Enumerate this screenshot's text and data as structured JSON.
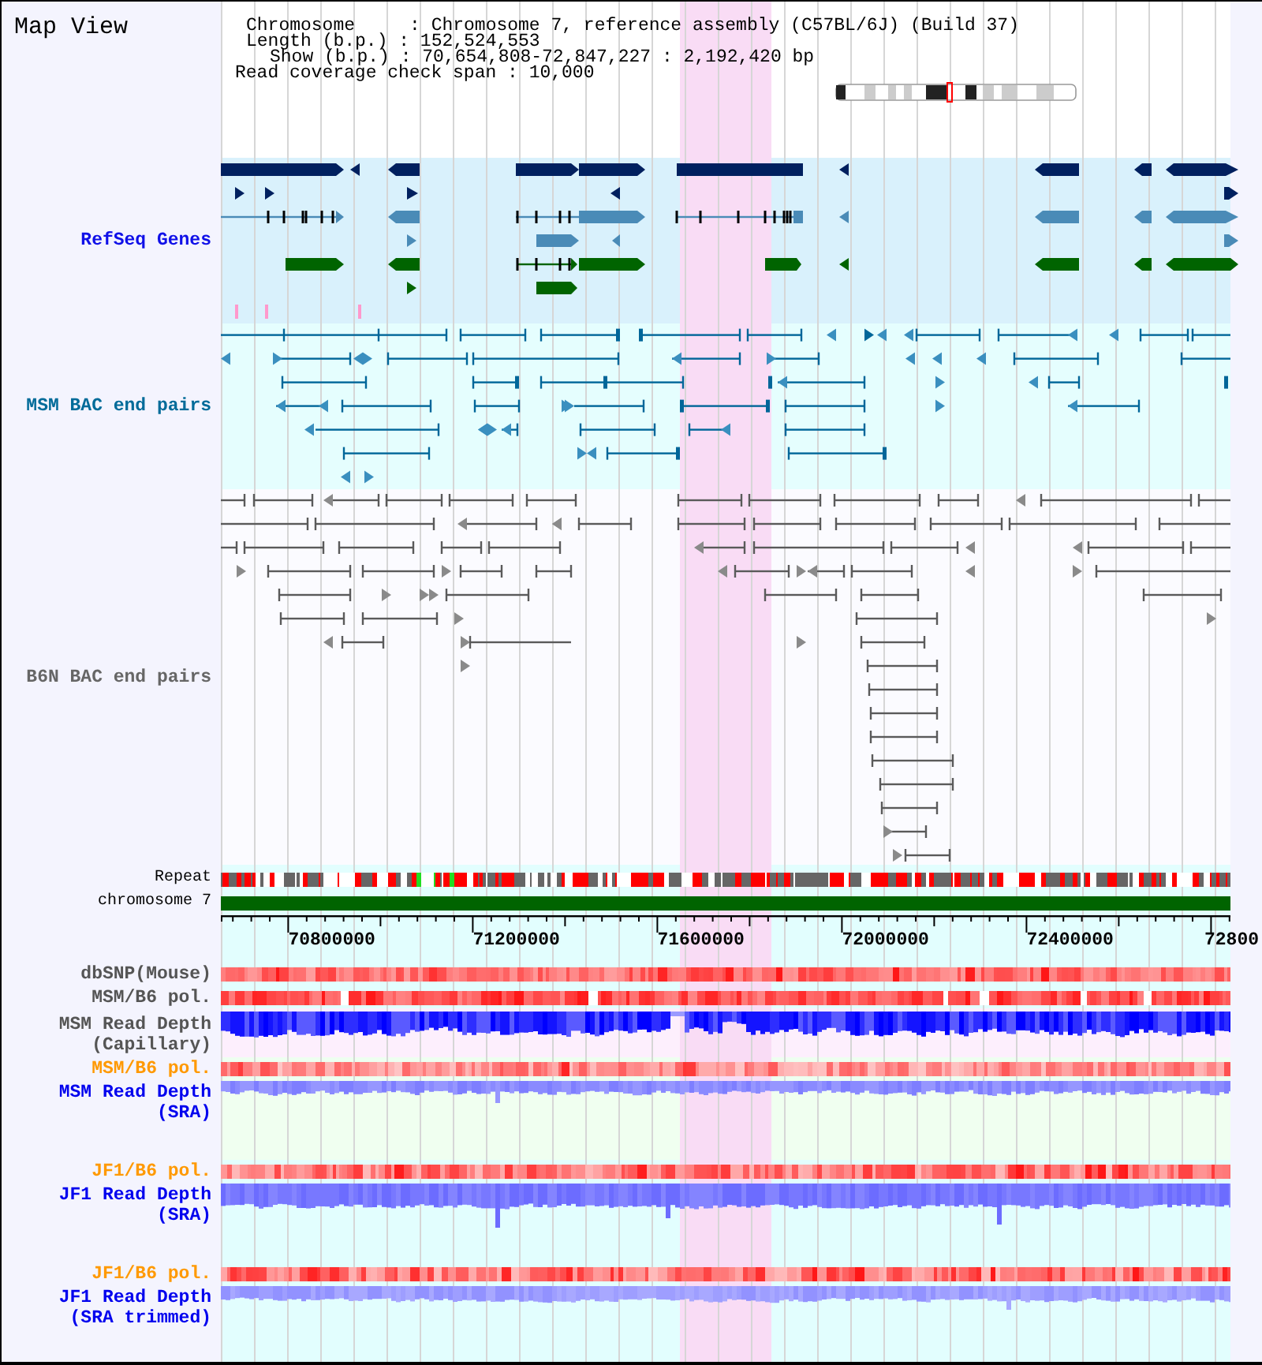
{
  "title": "Map View",
  "header": {
    "lines": [
      "Chromosome     : Chromosome 7, reference assembly (C57BL/6J) (Build 37)",
      "Length (b.p.) : 152,524,553",
      "Show (b.p.) : 70,654,808-72,847,227 : 2,192,420 bp",
      "Read coverage check span : 10,000"
    ]
  },
  "tracks": [
    {
      "kind": "genes",
      "label": "RefSeq Genes",
      "color": "#1010e8"
    },
    {
      "kind": "bac_pairs",
      "label": "MSM BAC end pairs",
      "color": "#006b99"
    },
    {
      "kind": "bac_pairs",
      "label": "B6N BAC end pairs",
      "color": "#666666"
    },
    {
      "kind": "repeat",
      "label": "Repeat",
      "color": "#000000"
    },
    {
      "kind": "chromosome",
      "label": "chromosome 7",
      "color": "#000000"
    },
    {
      "kind": "axis",
      "ticks": [
        "70800000",
        "71200000",
        "71600000",
        "72000000",
        "72400000",
        "72800"
      ]
    },
    {
      "kind": "heat",
      "label": "dbSNP(Mouse)",
      "color": "#555555"
    },
    {
      "kind": "heat",
      "label": "MSM/B6 pol.",
      "color": "#555555"
    },
    {
      "kind": "depth",
      "label": "MSM Read Depth (Capillary)",
      "color": "#555555"
    },
    {
      "kind": "heat",
      "label": "MSM/B6 pol.",
      "color": "#ff9900"
    },
    {
      "kind": "depth",
      "label": "MSM Read Depth (SRA)",
      "color": "#0000ee"
    },
    {
      "kind": "heat",
      "label": "JF1/B6 pol.",
      "color": "#ff9900"
    },
    {
      "kind": "depth",
      "label": "JF1 Read Depth (SRA)",
      "color": "#0000ee"
    },
    {
      "kind": "heat",
      "label": "JF1/B6 pol.",
      "color": "#ff9900"
    },
    {
      "kind": "depth",
      "label": "JF1 Read Depth (SRA trimmed)",
      "color": "#0000ee"
    }
  ]
}
